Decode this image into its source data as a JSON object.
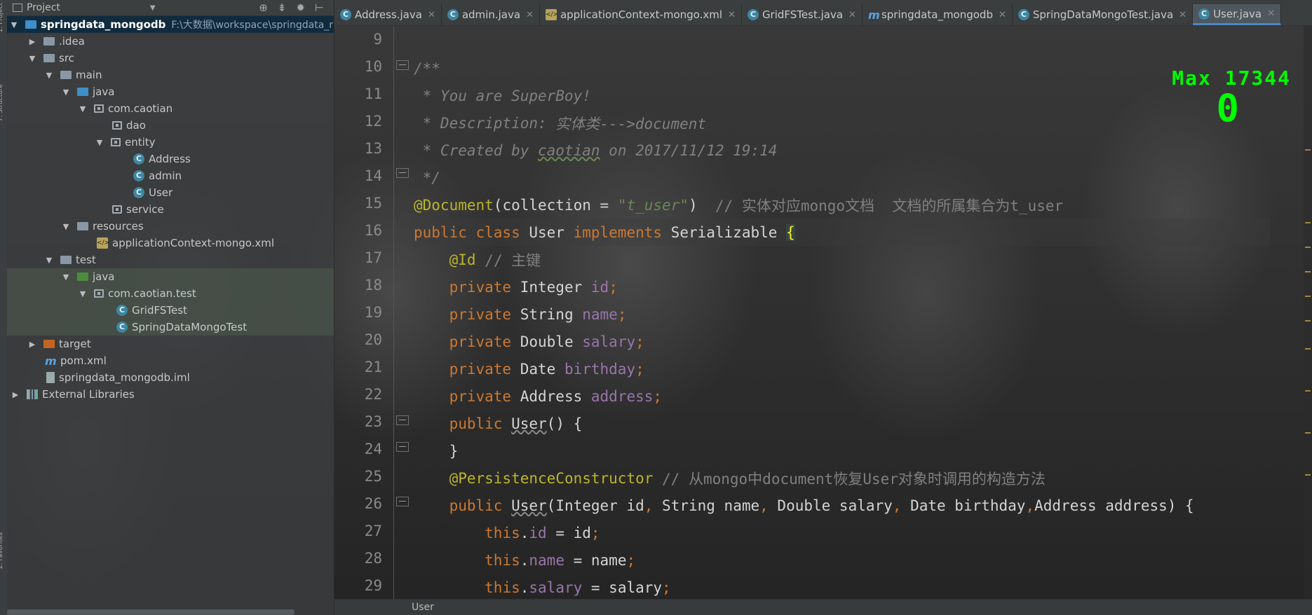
{
  "project_panel": {
    "title": "Project",
    "tree": [
      {
        "label": "springdata_mongodb",
        "path": "F:\\大数据\\workspace\\springdata_r"
      },
      {
        "label": ".idea"
      },
      {
        "label": "src"
      },
      {
        "label": "main"
      },
      {
        "label": "java"
      },
      {
        "label": "com.caotian"
      },
      {
        "label": "dao"
      },
      {
        "label": "entity"
      },
      {
        "label": "Address"
      },
      {
        "label": "admin"
      },
      {
        "label": "User"
      },
      {
        "label": "service"
      },
      {
        "label": "resources"
      },
      {
        "label": "applicationContext-mongo.xml"
      },
      {
        "label": "test"
      },
      {
        "label": "java"
      },
      {
        "label": "com.caotian.test"
      },
      {
        "label": "GridFSTest"
      },
      {
        "label": "SpringDataMongoTest"
      },
      {
        "label": "target"
      },
      {
        "label": "pom.xml"
      },
      {
        "label": "springdata_mongodb.iml"
      },
      {
        "label": "External Libraries"
      }
    ]
  },
  "tabs": [
    {
      "label": "Address.java"
    },
    {
      "label": "admin.java"
    },
    {
      "label": "applicationContext-mongo.xml"
    },
    {
      "label": "GridFSTest.java"
    },
    {
      "label": "springdata_mongodb"
    },
    {
      "label": "SpringDataMongoTest.java"
    },
    {
      "label": "User.java"
    }
  ],
  "editor": {
    "line_numbers": [
      "9",
      "10",
      "11",
      "12",
      "13",
      "14",
      "15",
      "16",
      "17",
      "18",
      "19",
      "20",
      "21",
      "22",
      "23",
      "24",
      "25",
      "26",
      "27",
      "28",
      "29"
    ],
    "overlay_max": "Max 17344",
    "overlay_score": "0",
    "lines": {
      "l11": " * You are SuperBoy!",
      "l12_a": " * Description: ",
      "l12_b": "实体类--->document",
      "l13_a": " * Created by ",
      "l13_b": "caotian",
      "l13_c": " on 2017/11/12 19:14",
      "l15_annotation": "@Document",
      "l15_str": "\"t_user\"",
      "l15_comment": "// 实体对应mongo文档  文档的所属集合为t_user",
      "l17_annotation": "@Id",
      "l17_comment": "// 主键",
      "l25_annotation": "@PersistenceConstructor",
      "l25_comment": "// 从mongo中document恢复User对象时调用的构造方法"
    }
  },
  "status_bar": {
    "breadcrumb": "User"
  }
}
